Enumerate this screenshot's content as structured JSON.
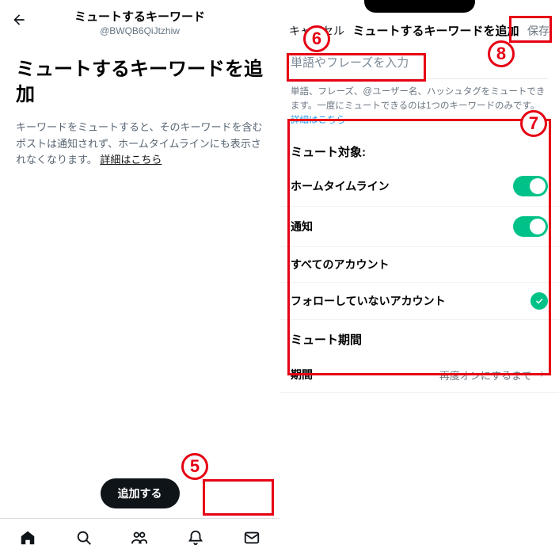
{
  "left": {
    "header_title": "ミュートするキーワード",
    "header_subtitle": "@BWQB6QiJtzhiw",
    "heading": "ミュートするキーワードを追加",
    "description_prefix": "キーワードをミュートすると、そのキーワードを含むポストは通知されず、ホームタイムラインにも表示されなくなります。",
    "description_link": "詳細はこちら",
    "add_button": "追加する"
  },
  "right": {
    "cancel": "キャンセル",
    "title": "ミュートするキーワードを追加",
    "save": "保存",
    "input_placeholder": "単語やフレーズを入力",
    "help_text": "単語、フレーズ、@ユーザー名、ハッシュタグをミュートできます。一度にミュートできるのは1つのキーワードのみです。",
    "help_link": "詳細はこちら",
    "section_target": "ミュート対象:",
    "row_home": "ホームタイムライン",
    "row_notif": "通知",
    "row_all_accounts": "すべてのアカウント",
    "row_not_following": "フォローしていないアカウント",
    "section_period": "ミュート期間",
    "row_period_label": "期間",
    "row_period_value": "再度オンにするまで"
  },
  "markers": {
    "m5": "5",
    "m6": "6",
    "m7": "7",
    "m8": "8"
  }
}
